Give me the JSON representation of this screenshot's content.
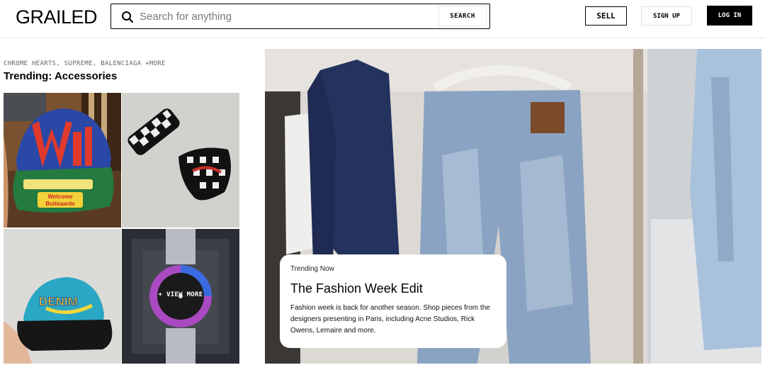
{
  "header": {
    "logo": "GRAILED",
    "search_placeholder": "Search for anything",
    "search_button": "SEARCH",
    "sell": "SELL",
    "sign_up": "SIGN UP",
    "log_in": "LOG IN"
  },
  "trending": {
    "brands": "CHROME HEARTS, SUPREME, BALENCIAGA +MORE",
    "title": "Trending: Accessories",
    "view_more": "+ VIEW MORE",
    "tiles": [
      {
        "icon": "cap-icon",
        "text_1": "Welcome",
        "text_2": "Buiteaards"
      },
      {
        "icon": "checkered-bandana-icon"
      },
      {
        "icon": "denim-cap-icon",
        "text": "DENIM"
      },
      {
        "icon": "watch-icon"
      }
    ]
  },
  "hero": {
    "eyebrow": "Trending Now",
    "title": "The Fashion Week Edit",
    "description": "Fashion week is back for another season. Shop pieces from the designers presenting in Paris, including Acne Studios, Rick Owens, Lemaire and more."
  },
  "colors": {
    "primary": "#000000",
    "background": "#ffffff",
    "border": "#e6e6e6"
  }
}
